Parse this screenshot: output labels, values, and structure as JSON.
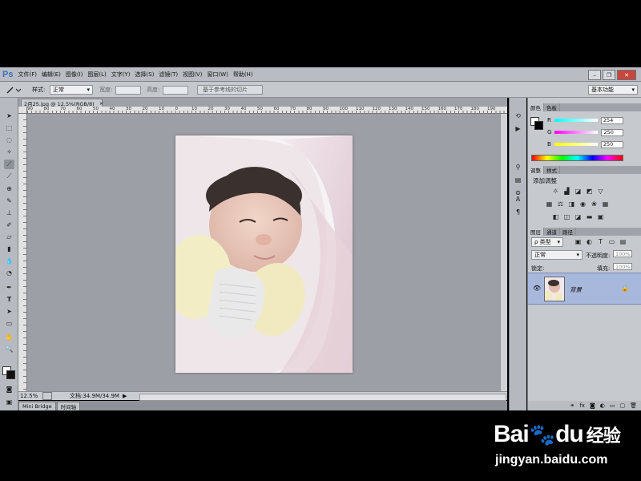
{
  "app": {
    "logo": "Ps"
  },
  "menu": [
    "文件(F)",
    "编辑(E)",
    "图像(I)",
    "图层(L)",
    "文字(Y)",
    "选择(S)",
    "滤镜(T)",
    "视图(V)",
    "窗口(W)",
    "帮助(H)"
  ],
  "options": {
    "style_label": "样式:",
    "style_value": "正常",
    "width_label": "宽度:",
    "height_label": "高度:",
    "guides_button": "基于参考线的切片",
    "workspace": "基本功能"
  },
  "document": {
    "tab_title": "2月25.jpg @ 12.5%(RGB/8)",
    "ruler_labels": [
      "90",
      "80",
      "70",
      "60",
      "50",
      "40",
      "30",
      "20",
      "10",
      "0",
      "10",
      "20",
      "30",
      "40",
      "50",
      "60",
      "70",
      "80",
      "90",
      "100",
      "110",
      "120",
      "130",
      "140",
      "150",
      "160",
      "170",
      "180",
      "190"
    ],
    "zoom": "12.5%",
    "doc_info": "文档:34.9M/34.9M"
  },
  "bottom_tabs": [
    "Mini Bridge",
    "时间轴"
  ],
  "color_panel": {
    "tabs": [
      "颜色",
      "色板"
    ],
    "r_label": "R",
    "g_label": "G",
    "b_label": "B",
    "r": "254",
    "g": "250",
    "b": "250"
  },
  "adjustments_panel": {
    "tabs": [
      "调整",
      "样式"
    ],
    "title": "添加调整"
  },
  "layers_panel": {
    "tabs": [
      "图层",
      "通道",
      "路径"
    ],
    "kind_filter": "ρ 类型",
    "blend_mode": "正常",
    "opacity_label": "不透明度:",
    "opacity": "100%",
    "lock_label": "锁定:",
    "fill_label": "填充:",
    "fill": "100%",
    "layer_name": "背景"
  },
  "watermark": {
    "brand": "Bai",
    "brand_suffix": "du",
    "site_cn": "经验",
    "url": "jingyan.baidu.com"
  }
}
